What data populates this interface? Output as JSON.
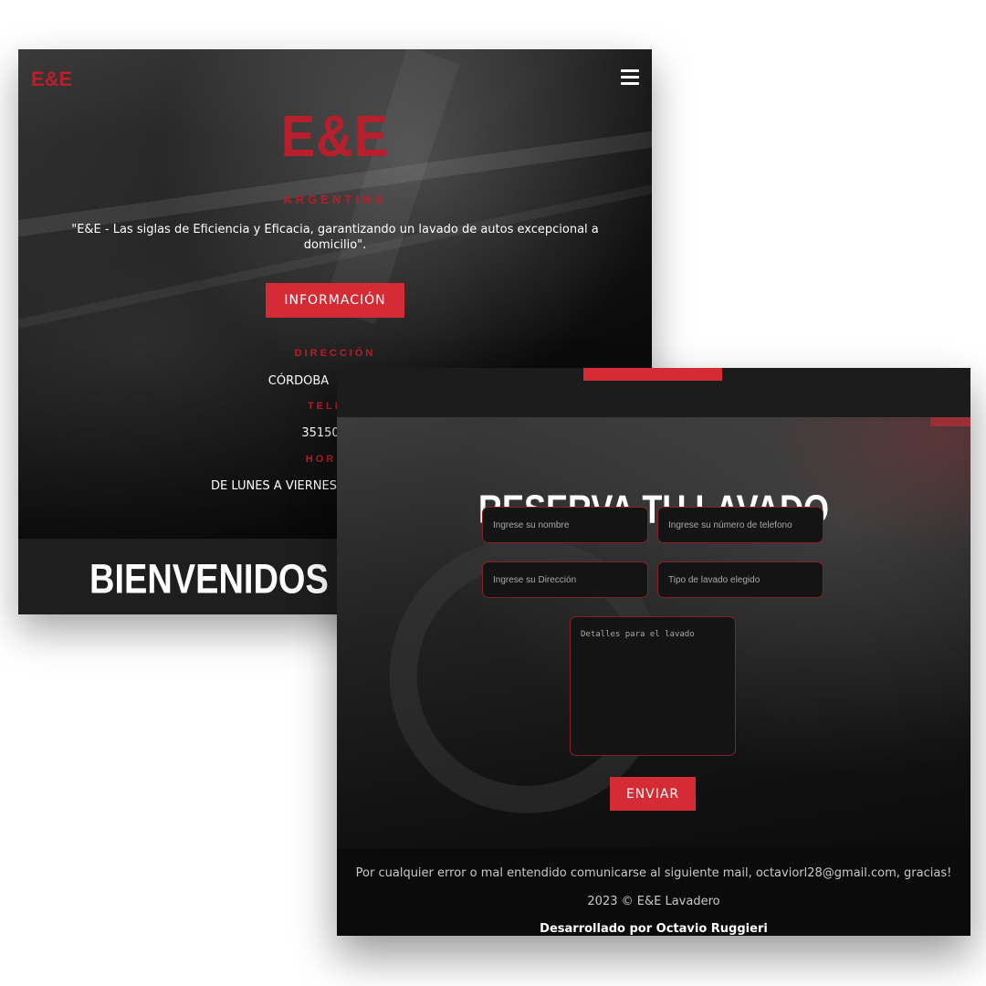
{
  "landing": {
    "nav_logo": "E&E",
    "hero_logo": "E&E",
    "country": "ARGENTINA",
    "tagline": "\"E&E - Las siglas de Eficiencia y Eficacia, garantizando un lavado de autos excepcional a domicilio\".",
    "info_button": "INFORMACIÓN",
    "address_label": "DIRECCIÓN",
    "address_value": "CÓRDOBA",
    "phone_label": "TELE",
    "phone_value": "35150",
    "hours_label": "HORA",
    "hours_value": "DE LUNES A VIERNES",
    "welcome": "BIENVENIDOS A NU"
  },
  "booking": {
    "title": "RESERVA TU LAVADO",
    "fields": {
      "name_placeholder": "Ingrese su nombre",
      "phone_placeholder": "Ingrese su número de telefono",
      "address_placeholder": "Ingrese su Dirección",
      "wash_type_placeholder": "Tipo de lavado elegido",
      "details_placeholder": "Detalles para el lavado"
    },
    "send_button": "ENVIAR"
  },
  "footer": {
    "contact_note": "Por cualquier error o mal entendido comunicarse al siguiente mail, octaviorl28@gmail.com, gracias!",
    "copyright": "2023 © E&E Lavadero",
    "credits": "Desarrollado por Octavio Ruggieri"
  },
  "colors": {
    "accent": "#d42b34",
    "brand_red": "#b81f2c",
    "dark_bg": "#0b0b0b"
  },
  "icons": {
    "menu": "hamburger-menu-icon"
  }
}
